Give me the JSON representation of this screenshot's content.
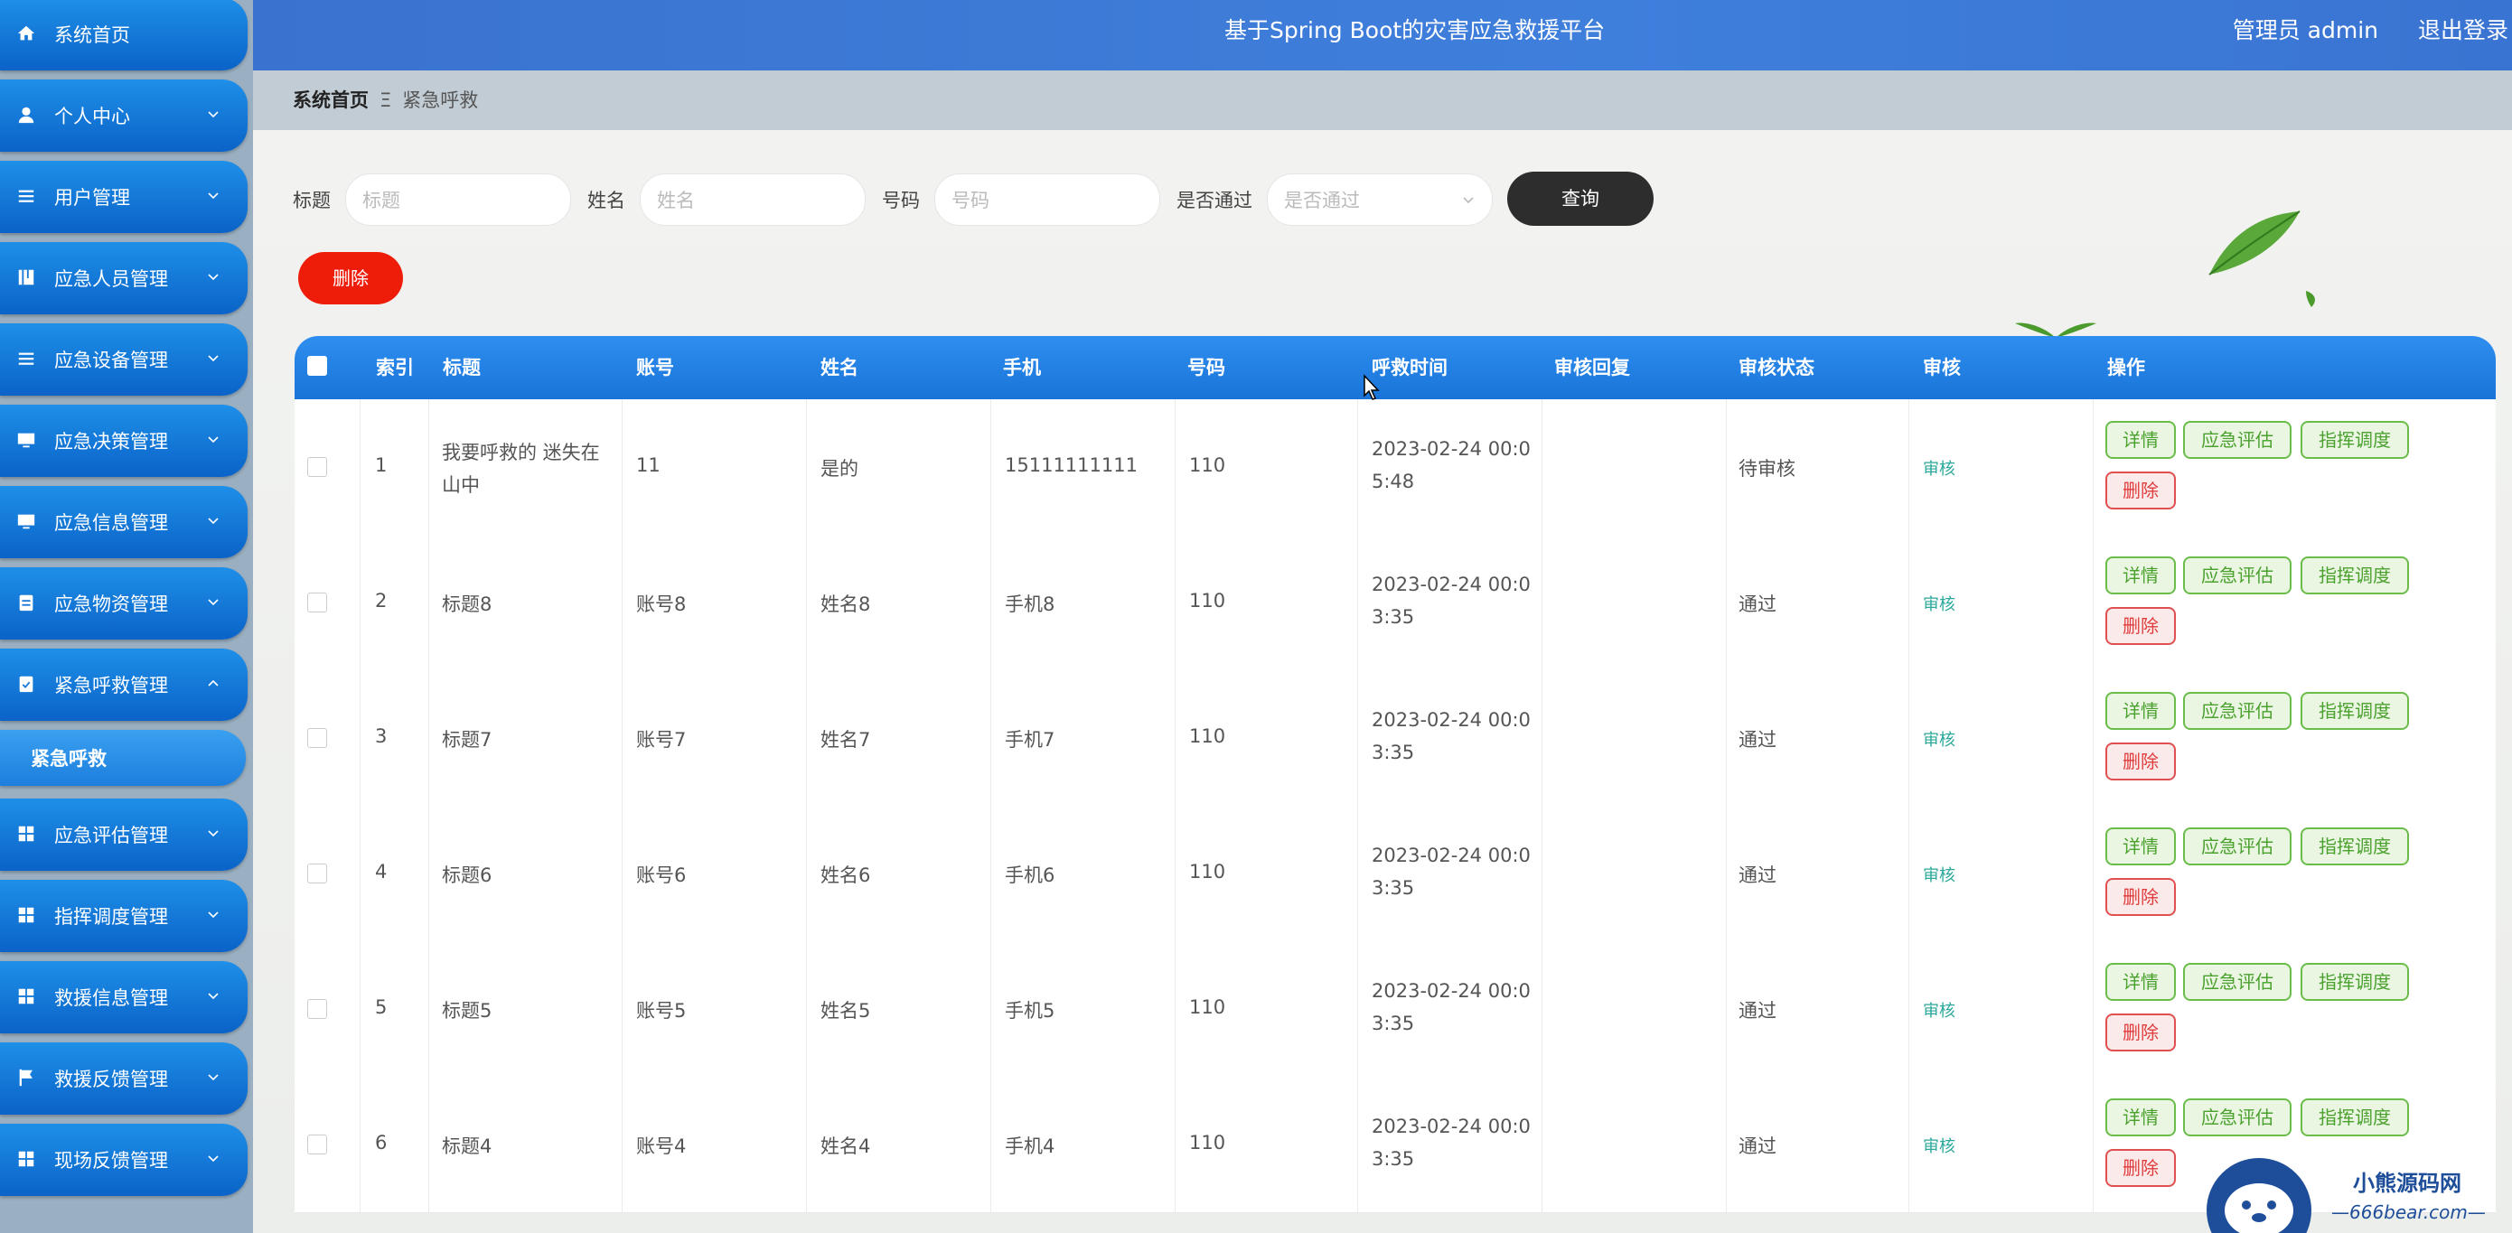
{
  "header": {
    "title": "基于Spring Boot的灾害应急救援平台",
    "admin_label": "管理员 admin",
    "logout_label": "退出登录"
  },
  "sidebar": {
    "items": [
      {
        "label": "系统首页",
        "icon": "home-icon"
      },
      {
        "label": "个人中心",
        "icon": "user-icon"
      },
      {
        "label": "用户管理",
        "icon": "list-icon"
      },
      {
        "label": "应急人员管理",
        "icon": "book-icon"
      },
      {
        "label": "应急设备管理",
        "icon": "list-icon"
      },
      {
        "label": "应急决策管理",
        "icon": "monitor-icon"
      },
      {
        "label": "应急信息管理",
        "icon": "monitor-icon"
      },
      {
        "label": "应急物资管理",
        "icon": "clipboard-icon"
      },
      {
        "label": "紧急呼救管理",
        "icon": "clipboard-check-icon"
      },
      {
        "label": "应急评估管理",
        "icon": "grid-icon"
      },
      {
        "label": "指挥调度管理",
        "icon": "grid-icon"
      },
      {
        "label": "救援信息管理",
        "icon": "grid-icon"
      },
      {
        "label": "救援反馈管理",
        "icon": "flag-icon"
      },
      {
        "label": "现场反馈管理",
        "icon": "grid-icon"
      }
    ],
    "active_sub": "紧急呼救"
  },
  "breadcrumb": {
    "home": "系统首页",
    "separator": "Ξ",
    "current": "紧急呼救"
  },
  "search": {
    "title_label": "标题",
    "title_placeholder": "标题",
    "name_label": "姓名",
    "name_placeholder": "姓名",
    "number_label": "号码",
    "number_placeholder": "号码",
    "passed_label": "是否通过",
    "passed_placeholder": "是否通过",
    "query_button": "查询"
  },
  "delete_button": "删除",
  "table": {
    "headers": [
      "索引",
      "标题",
      "账号",
      "姓名",
      "手机",
      "号码",
      "呼救时间",
      "审核回复",
      "审核状态",
      "审核",
      "操作"
    ],
    "rows": [
      {
        "index": "1",
        "title_l1": "我要呼救的 迷失在",
        "title_l2": "山中",
        "account": "11",
        "name": "是的",
        "phone": "15111111111",
        "number": "110",
        "time_l1": "2023-02-24 00:0",
        "time_l2": "5:48",
        "reply": "",
        "status": "待审核",
        "audit": "审核"
      },
      {
        "index": "2",
        "title_l1": "标题8",
        "title_l2": "",
        "account": "账号8",
        "name": "姓名8",
        "phone": "手机8",
        "number": "110",
        "time_l1": "2023-02-24 00:0",
        "time_l2": "3:35",
        "reply": "",
        "status": "通过",
        "audit": "审核"
      },
      {
        "index": "3",
        "title_l1": "标题7",
        "title_l2": "",
        "account": "账号7",
        "name": "姓名7",
        "phone": "手机7",
        "number": "110",
        "time_l1": "2023-02-24 00:0",
        "time_l2": "3:35",
        "reply": "",
        "status": "通过",
        "audit": "审核"
      },
      {
        "index": "4",
        "title_l1": "标题6",
        "title_l2": "",
        "account": "账号6",
        "name": "姓名6",
        "phone": "手机6",
        "number": "110",
        "time_l1": "2023-02-24 00:0",
        "time_l2": "3:35",
        "reply": "",
        "status": "通过",
        "audit": "审核"
      },
      {
        "index": "5",
        "title_l1": "标题5",
        "title_l2": "",
        "account": "账号5",
        "name": "姓名5",
        "phone": "手机5",
        "number": "110",
        "time_l1": "2023-02-24 00:0",
        "time_l2": "3:35",
        "reply": "",
        "status": "通过",
        "audit": "审核"
      },
      {
        "index": "6",
        "title_l1": "标题4",
        "title_l2": "",
        "account": "账号4",
        "name": "姓名4",
        "phone": "手机4",
        "number": "110",
        "time_l1": "2023-02-24 00:0",
        "time_l2": "3:35",
        "reply": "",
        "status": "通过",
        "audit": "审核"
      }
    ],
    "actions": {
      "detail": "详情",
      "assess": "应急评估",
      "dispatch": "指挥调度",
      "delete": "删除"
    }
  },
  "watermark": {
    "line1": "小熊源码网",
    "line2": "—666bear.com—"
  }
}
